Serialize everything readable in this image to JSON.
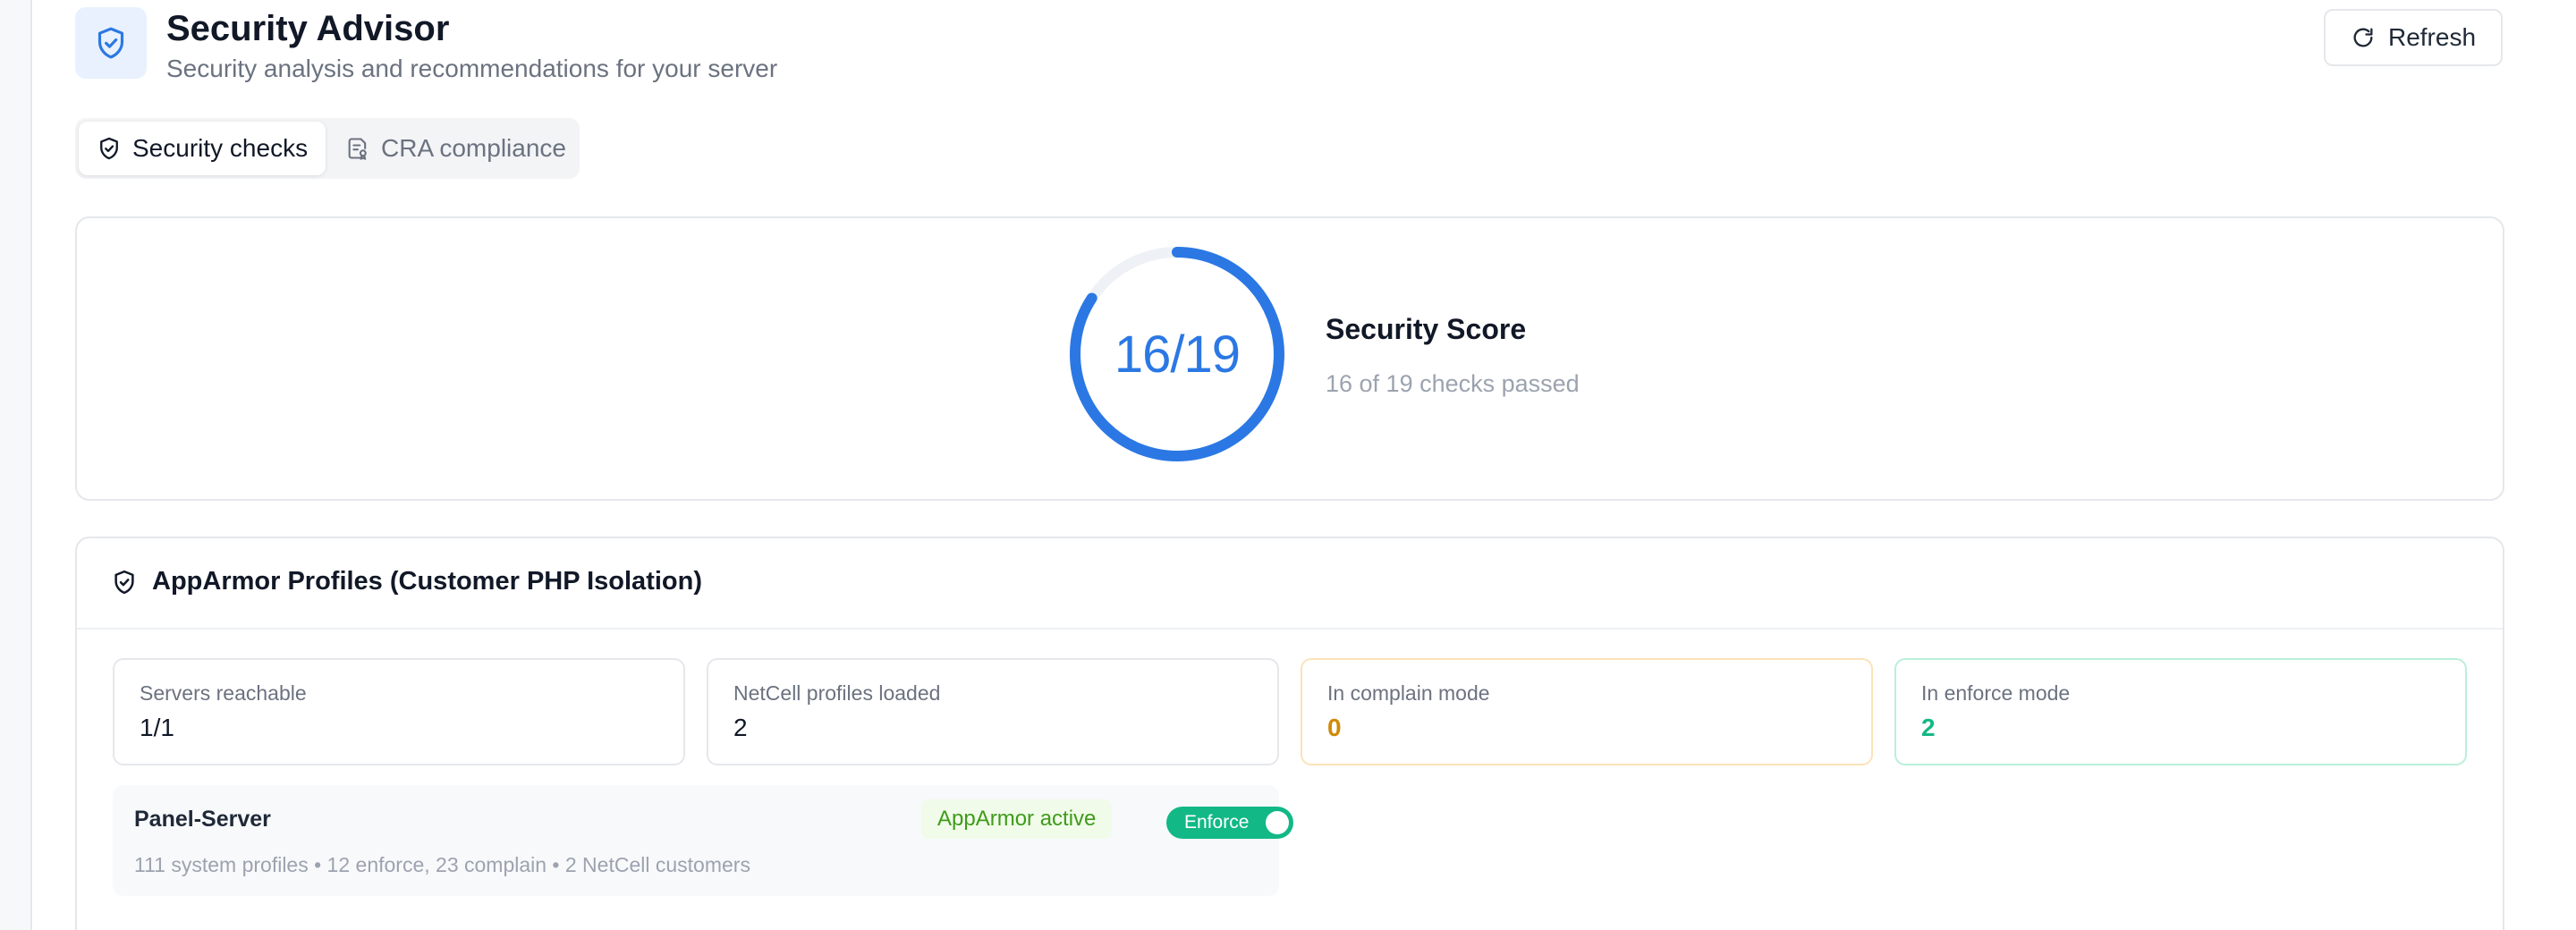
{
  "header": {
    "title": "Security Advisor",
    "subtitle": "Security analysis and recommendations for your server",
    "refresh_label": "Refresh"
  },
  "tabs": [
    {
      "label": "Security checks",
      "active": true,
      "icon": "shield-check-icon"
    },
    {
      "label": "CRA compliance",
      "active": false,
      "icon": "document-badge-icon"
    }
  ],
  "score": {
    "value": "16/19",
    "passed": 16,
    "total": 19,
    "label": "Security Score",
    "caption": "16 of 19 checks passed"
  },
  "apparmor": {
    "title": "AppArmor Profiles (Customer PHP Isolation)",
    "stats": [
      {
        "label": "Servers reachable",
        "value": "1/1"
      },
      {
        "label": "NetCell profiles loaded",
        "value": "2"
      },
      {
        "label": "In complain mode",
        "value": "0"
      },
      {
        "label": "In enforce mode",
        "value": "2"
      }
    ],
    "servers": [
      {
        "name": "Panel-Server",
        "status": "AppArmor active",
        "mode": "Enforce",
        "enforce_on": true,
        "details": "111 system profiles • 12 enforce, 23 complain • 2 NetCell customers"
      }
    ]
  },
  "colors": {
    "accent": "#2b78e4",
    "warning": "#d08a0a",
    "success": "#16b886",
    "toggle_on": "#12b886",
    "badge_text": "#3f9b1a"
  }
}
